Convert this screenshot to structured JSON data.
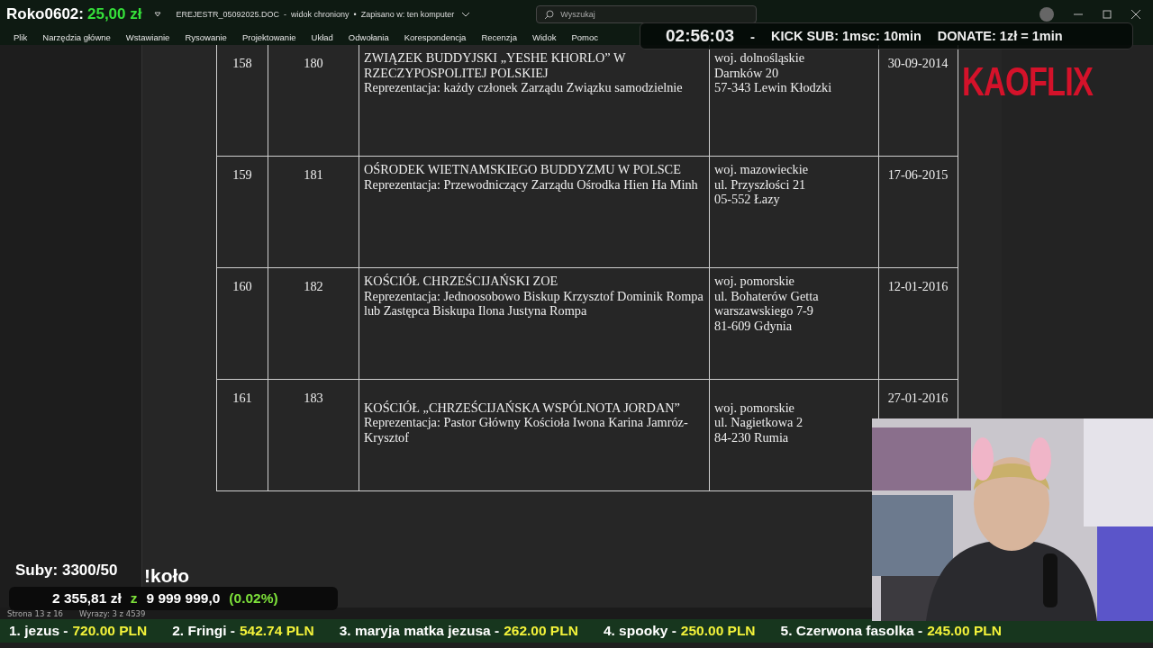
{
  "donation_alert": {
    "user": "Roko0602:",
    "amount": "25,00 zł"
  },
  "window": {
    "title": "EREJESTR_05092025.DOC  -  widok chroniony  •  Zapisano w: ten komputer"
  },
  "search": {
    "placeholder": "Wyszukaj"
  },
  "menu": [
    "Plik",
    "Narzędzia główne",
    "Wstawianie",
    "Rysowanie",
    "Projektowanie",
    "Układ",
    "Odwołania",
    "Korespondencja",
    "Recenzja",
    "Widok",
    "Pomoc"
  ],
  "table": {
    "rows": [
      {
        "no": "158",
        "id": "180",
        "name": "ZWIĄZEK BUDDYJSKI „YESHE KHORLO” W RZECZYPOSPOLITEJ POLSKIEJ",
        "representation": "Reprezentacja: każdy członek Zarządu Związku samodzielnie",
        "address": [
          "woj. dolnośląskie",
          "Darnków 20",
          "57-343 Lewin Kłodzki"
        ],
        "date": "30-09-2014",
        "blank_line_before": false
      },
      {
        "no": "159",
        "id": "181",
        "name": "OŚRODEK WIETNAMSKIEGO BUDDYZMU W POLSCE",
        "representation": "Reprezentacja: Przewodniczący Zarządu Ośrodka Hien Ha Minh",
        "address": [
          "woj. mazowieckie",
          "ul. Przyszłości 21",
          "05-552 Łazy"
        ],
        "date": "17-06-2015",
        "blank_line_before": false
      },
      {
        "no": "160",
        "id": "182",
        "name": "KOŚCIÓŁ CHRZEŚCIJAŃSKI ZOE",
        "representation": "Reprezentacja: Jednoosobowo Biskup Krzysztof Dominik Rompa lub Zastępca Biskupa Ilona Justyna Rompa",
        "address": [
          "woj. pomorskie",
          "ul. Bohaterów Getta warszawskiego 7-9",
          "81-609 Gdynia"
        ],
        "date": "12-01-2016",
        "blank_line_before": false
      },
      {
        "no": "161",
        "id": "183",
        "name": "KOŚCIÓŁ „CHRZEŚCIJAŃSKA WSPÓLNOTA JORDAN”",
        "representation": "Reprezentacja: Pastor Główny Kościoła Iwona Karina Jamróz-Krysztof",
        "address": [
          "woj. pomorskie",
          "ul. Nagietkowa 2",
          "84-230 Rumia"
        ],
        "date": "27-01-2016",
        "blank_line_before": true
      }
    ]
  },
  "status_bar": [
    "Strona 13 z 16",
    "Wyrazy: 3 z 4539"
  ],
  "stream_timer": {
    "time": "02:56:03",
    "separator": "-",
    "sub_rule": "KICK SUB: 1msc: 10min",
    "donate_rule": "DONATE: 1zł = 1min"
  },
  "channel_logo": "KAOFLIX",
  "subs_goal": "Suby: 3300/50",
  "command": "!koło",
  "donation_goal": {
    "raised": "2 355,81 zł",
    "of": "z",
    "target": "9 999 999,0",
    "percent": "(0.02%)"
  },
  "top_donors": [
    {
      "rank_name": "1. jezus -",
      "amount": "720.00 PLN"
    },
    {
      "rank_name": "2. Fringi -",
      "amount": "542.74 PLN"
    },
    {
      "rank_name": "3. maryja matka jezusa -",
      "amount": "262.00 PLN"
    },
    {
      "rank_name": "4. spooky -",
      "amount": "250.00 PLN"
    },
    {
      "rank_name": "5. Czerwona fasolka -",
      "amount": "245.00 PLN"
    }
  ],
  "webcam": {
    "kind": "picture"
  }
}
